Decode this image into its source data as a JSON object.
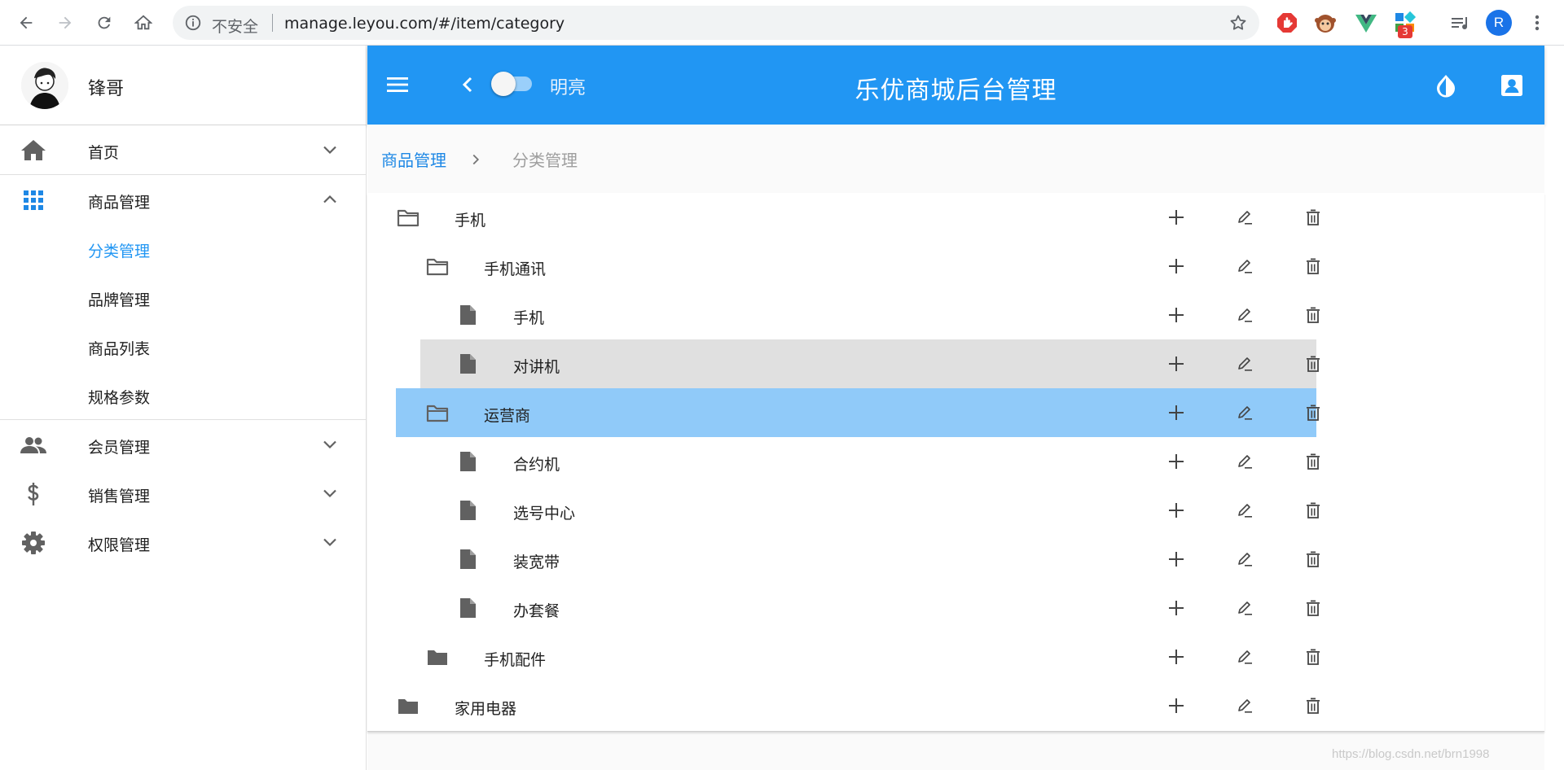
{
  "browser": {
    "security_label": "不安全",
    "url": "manage.leyou.com/#/item/category",
    "extension_badge": "3",
    "profile_initial": "R"
  },
  "sidebar": {
    "user_name": "锋哥",
    "items": [
      {
        "label": "首页",
        "icon": "home-icon",
        "expanded": false
      },
      {
        "label": "商品管理",
        "icon": "apps-grid-icon",
        "expanded": true,
        "children": [
          {
            "label": "分类管理",
            "active": true
          },
          {
            "label": "品牌管理",
            "active": false
          },
          {
            "label": "商品列表",
            "active": false
          },
          {
            "label": "规格参数",
            "active": false
          }
        ]
      },
      {
        "label": "会员管理",
        "icon": "people-icon",
        "expanded": false
      },
      {
        "label": "销售管理",
        "icon": "dollar-icon",
        "expanded": false
      },
      {
        "label": "权限管理",
        "icon": "gear-icon",
        "expanded": false
      }
    ]
  },
  "appbar": {
    "mode_label": "明亮",
    "title": "乐优商城后台管理",
    "dark_mode": false
  },
  "breadcrumb": {
    "parent": "商品管理",
    "current": "分类管理"
  },
  "tree": [
    {
      "label": "手机",
      "level": 0,
      "type": "folder-open",
      "state": ""
    },
    {
      "label": "手机通讯",
      "level": 1,
      "type": "folder-open",
      "state": ""
    },
    {
      "label": "手机",
      "level": 2,
      "type": "file",
      "state": ""
    },
    {
      "label": "对讲机",
      "level": 2,
      "type": "file",
      "state": "hover"
    },
    {
      "label": "运营商",
      "level": 1,
      "type": "folder-open",
      "state": "selected"
    },
    {
      "label": "合约机",
      "level": 2,
      "type": "file",
      "state": ""
    },
    {
      "label": "选号中心",
      "level": 2,
      "type": "file",
      "state": ""
    },
    {
      "label": "装宽带",
      "level": 2,
      "type": "file",
      "state": ""
    },
    {
      "label": "办套餐",
      "level": 2,
      "type": "file",
      "state": ""
    },
    {
      "label": "手机配件",
      "level": 1,
      "type": "folder",
      "state": ""
    },
    {
      "label": "家用电器",
      "level": 0,
      "type": "folder",
      "state": ""
    }
  ],
  "watermark": "https://blog.csdn.net/brn1998",
  "colors": {
    "primary": "#2196f3",
    "selected_row": "#90caf9",
    "hover_row": "#e0e0e0",
    "active_link": "#1e88e5"
  }
}
